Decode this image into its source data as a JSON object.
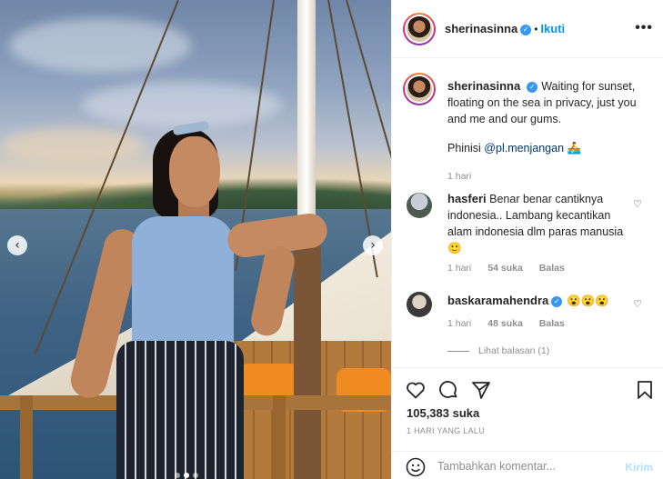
{
  "post": {
    "username": "sherinasinna",
    "follow_label": "Ikuti",
    "separator": "•",
    "more_label": "•••"
  },
  "caption": {
    "username": "sherinasinna",
    "text": "Waiting for sunset, floating on the sea in privacy, just you and me and our gums.",
    "line2_prefix": "Phinisi ",
    "mention": "@pl.menjangan",
    "emoji": "🚣",
    "time": "1 hari"
  },
  "comments": [
    {
      "username": "hasferi",
      "text": "Benar benar cantiknya indonesia.. Lambang kecantikan alam indonesia dlm paras manusia 🙂",
      "time": "1 hari",
      "likes": "54 suka",
      "reply_label": "Balas"
    },
    {
      "username": "baskaramahendra",
      "text": "😮😮😮",
      "time": "1 hari",
      "likes": "48 suka",
      "reply_label": "Balas",
      "view_replies": "Lihat balasan (1)"
    }
  ],
  "likes_count": "105,383 suka",
  "post_time": "1 HARI YANG LALU",
  "add_comment": {
    "placeholder": "Tambahkan komentar...",
    "post_label": "Kirim"
  },
  "carousel": {
    "prev": "‹",
    "next": "›"
  },
  "colors": {
    "accent": "#0095f6",
    "verified": "#3897f0",
    "muted": "#8e8e8e"
  }
}
